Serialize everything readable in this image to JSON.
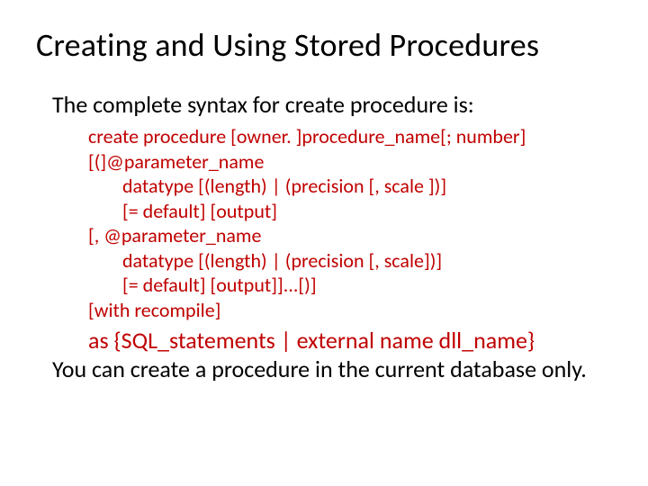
{
  "title": "Creating and Using Stored Procedures",
  "intro": "The complete syntax for create procedure is:",
  "syntax": {
    "l1": "create procedure [owner. ]procedure_name[; number]",
    "l2": "[(]@parameter_name",
    "l3": "datatype [(length) | (precision [, scale ])]",
    "l4": "[= default] [output]",
    "l5": "[, @parameter_name",
    "l6": "datatype [(length) | (precision [, scale])]",
    "l7": "[= default] [output]]...[)]",
    "l8": "[with recompile]"
  },
  "asline": "as {SQL_statements | external name dll_name}",
  "tail": "You can create a procedure in the current database only."
}
